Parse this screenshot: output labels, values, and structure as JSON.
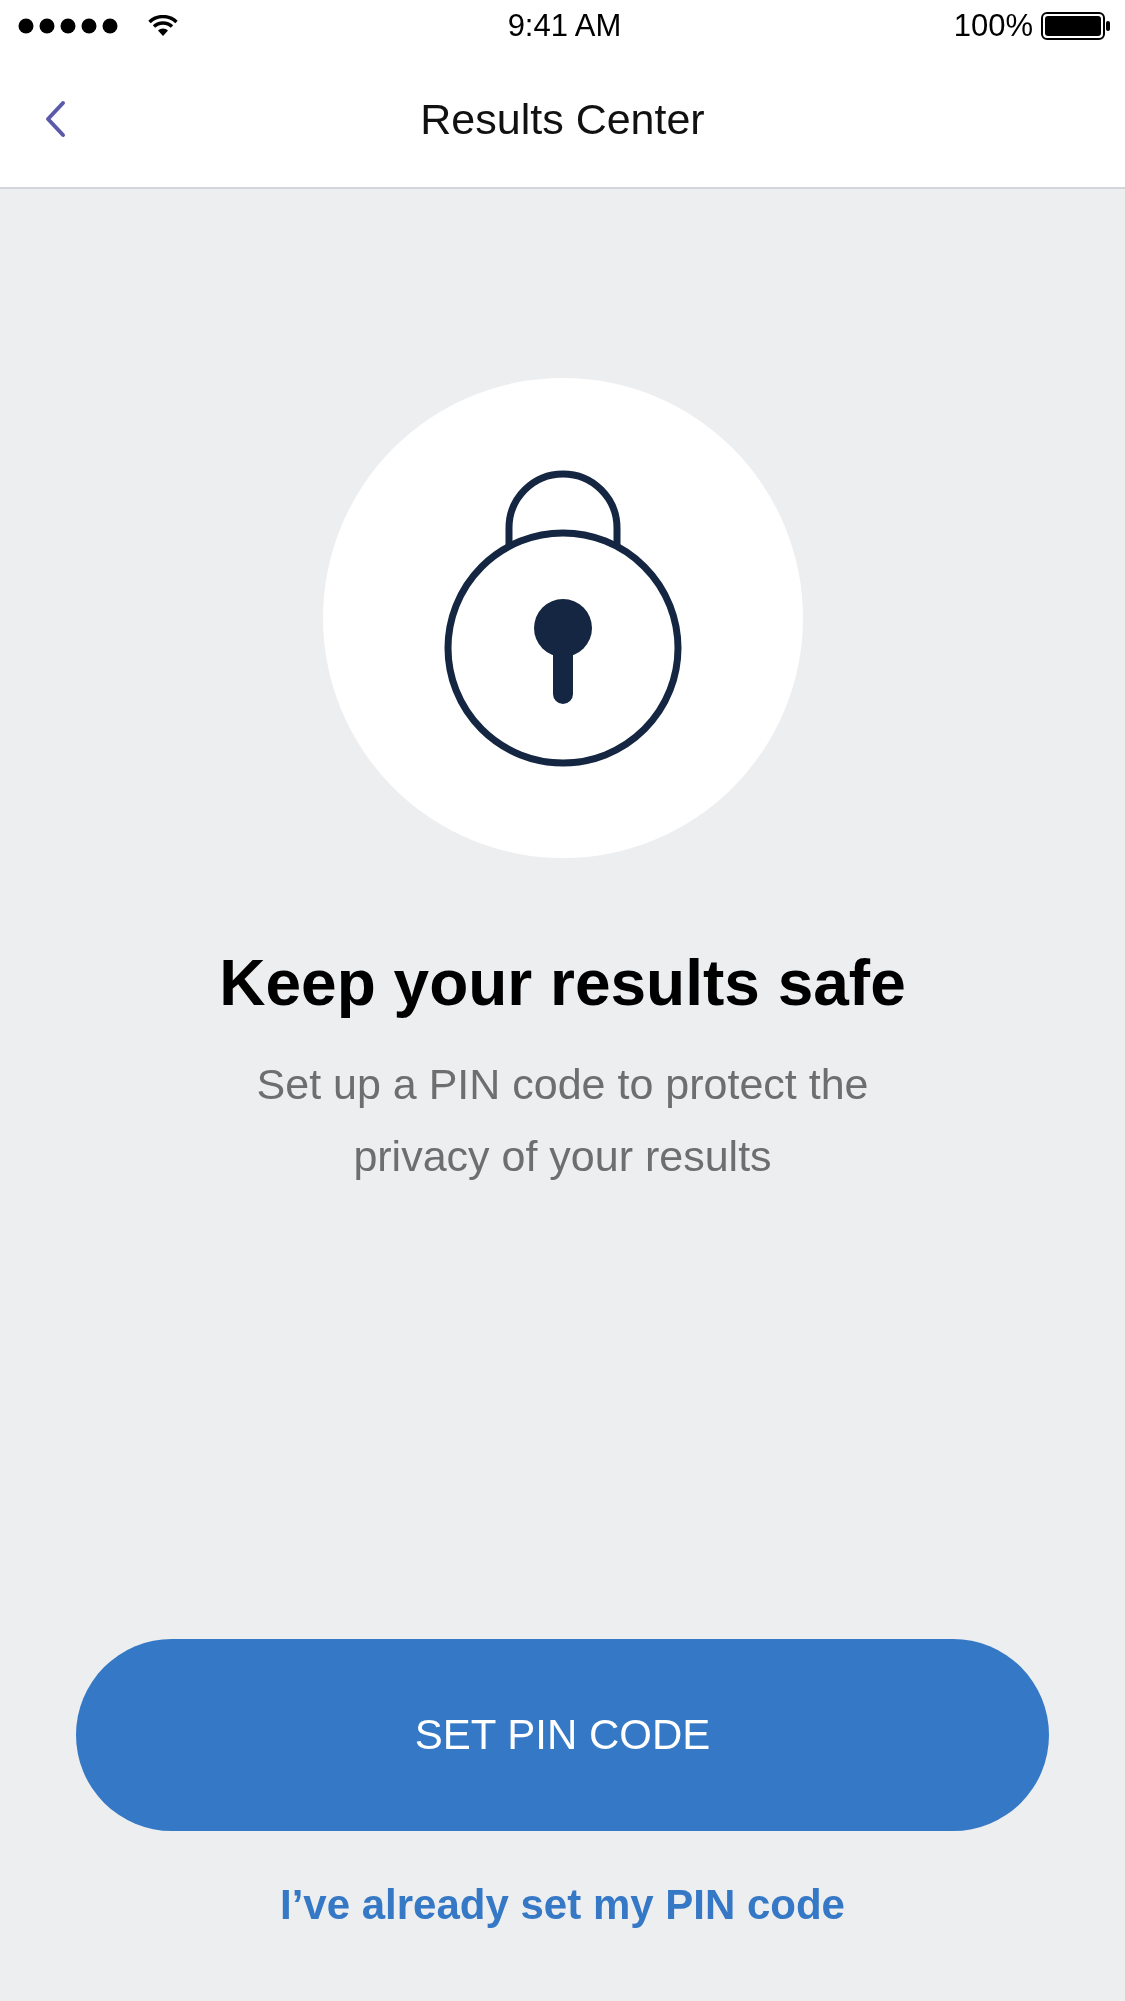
{
  "status_bar": {
    "time": "9:41 AM",
    "battery": "100%"
  },
  "nav": {
    "title": "Results Center"
  },
  "heading": "Keep your results safe",
  "description": "Set up a PIN code to protect the privacy of your results",
  "primary_button": "SET PIN CODE",
  "link": "I’ve already set my PIN code"
}
